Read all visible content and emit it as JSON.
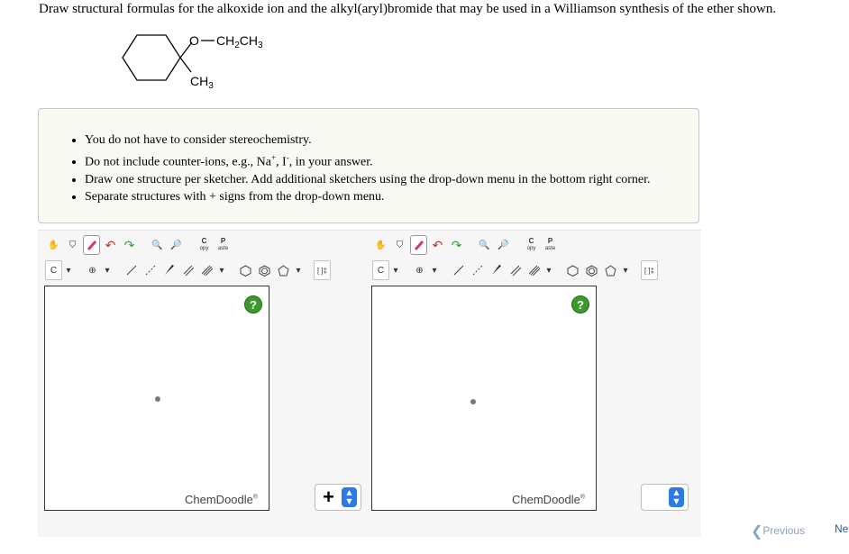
{
  "question": {
    "text": "Draw structural formulas for the alkoxide ion and the alkyl(aryl)bromide that may be used in a Williamson synthesis of the ether shown."
  },
  "molecule": {
    "o_label": "O",
    "ethyl_main": "CH",
    "ethyl_sub": "2",
    "ethyl_tail": "CH",
    "ethyl_tail_sub": "3",
    "methyl_main": "CH",
    "methyl_sub": "3"
  },
  "instructions": {
    "items": [
      {
        "pre": "You do not have to consider stereochemistry.",
        "na": "",
        "i": "",
        "post": ""
      },
      {
        "pre": "Do not include counter-ions, e.g., Na",
        "na": "+",
        "mid": ", I",
        "i": "-",
        "post": ", in your answer."
      },
      {
        "pre": "Draw one structure per sketcher. Add additional sketchers using the drop-down menu in the bottom right corner.",
        "na": "",
        "i": "",
        "post": ""
      },
      {
        "pre": "Separate structures with + signs from the drop-down menu.",
        "na": "",
        "i": "",
        "post": ""
      }
    ]
  },
  "toolbar": {
    "copy_top": "C",
    "copy_label": "opy",
    "paste_top": "P",
    "paste_label": "aste",
    "atom_label": "C",
    "charge_label": "⊕",
    "bracket_label": "[ ]‡"
  },
  "sketchers": [
    {
      "brand": "ChemDoodle",
      "reg": "®",
      "help": "?",
      "separator_value": "+"
    },
    {
      "brand": "ChemDoodle",
      "reg": "®",
      "help": "?",
      "separator_value": ""
    }
  ],
  "nav": {
    "previous": "Previous",
    "next": "Ne"
  },
  "colors": {
    "help_green": "#3c9a2c",
    "select_blue": "#2c7be5",
    "panel_bg": "#f9f9f3"
  }
}
